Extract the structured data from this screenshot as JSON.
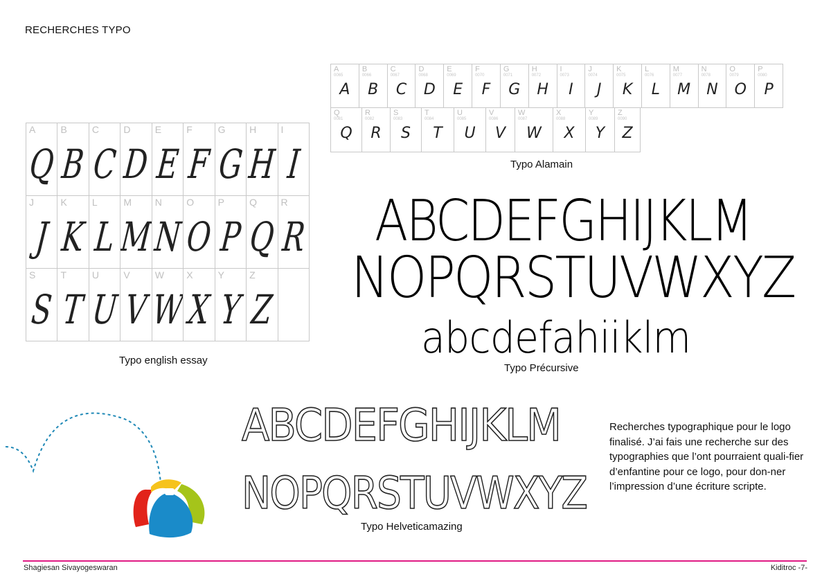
{
  "page_title": "RECHERCHES TYPO",
  "essay": {
    "caption": "Typo english essay",
    "cells": [
      {
        "label": "A",
        "glyph": "Q"
      },
      {
        "label": "B",
        "glyph": "B"
      },
      {
        "label": "C",
        "glyph": "C"
      },
      {
        "label": "D",
        "glyph": "D"
      },
      {
        "label": "E",
        "glyph": "E"
      },
      {
        "label": "F",
        "glyph": "F"
      },
      {
        "label": "G",
        "glyph": "G"
      },
      {
        "label": "H",
        "glyph": "H"
      },
      {
        "label": "I",
        "glyph": "I"
      },
      {
        "label": "J",
        "glyph": "J"
      },
      {
        "label": "K",
        "glyph": "K"
      },
      {
        "label": "L",
        "glyph": "L"
      },
      {
        "label": "M",
        "glyph": "M"
      },
      {
        "label": "N",
        "glyph": "N"
      },
      {
        "label": "O",
        "glyph": "O"
      },
      {
        "label": "P",
        "glyph": "P"
      },
      {
        "label": "Q",
        "glyph": "Q"
      },
      {
        "label": "R",
        "glyph": "R"
      },
      {
        "label": "S",
        "glyph": "S"
      },
      {
        "label": "T",
        "glyph": "T"
      },
      {
        "label": "U",
        "glyph": "U"
      },
      {
        "label": "V",
        "glyph": "V"
      },
      {
        "label": "W",
        "glyph": "W"
      },
      {
        "label": "X",
        "glyph": "X"
      },
      {
        "label": "Y",
        "glyph": "Y"
      },
      {
        "label": "Z",
        "glyph": "Z"
      },
      {
        "label": "",
        "glyph": ""
      }
    ]
  },
  "alamain": {
    "caption": "Typo Alamain",
    "row1": [
      {
        "label": "A",
        "code": "0065",
        "glyph": "A"
      },
      {
        "label": "B",
        "code": "0066",
        "glyph": "B"
      },
      {
        "label": "C",
        "code": "0067",
        "glyph": "C"
      },
      {
        "label": "D",
        "code": "0068",
        "glyph": "D"
      },
      {
        "label": "E",
        "code": "0069",
        "glyph": "E"
      },
      {
        "label": "F",
        "code": "0070",
        "glyph": "F"
      },
      {
        "label": "G",
        "code": "0071",
        "glyph": "G"
      },
      {
        "label": "H",
        "code": "0072",
        "glyph": "H"
      },
      {
        "label": "I",
        "code": "0073",
        "glyph": "I"
      },
      {
        "label": "J",
        "code": "0074",
        "glyph": "J"
      },
      {
        "label": "K",
        "code": "0075",
        "glyph": "K"
      },
      {
        "label": "L",
        "code": "0076",
        "glyph": "L"
      },
      {
        "label": "M",
        "code": "0077",
        "glyph": "M"
      },
      {
        "label": "N",
        "code": "0078",
        "glyph": "N"
      },
      {
        "label": "O",
        "code": "0079",
        "glyph": "O"
      },
      {
        "label": "P",
        "code": "0080",
        "glyph": "P"
      }
    ],
    "row2": [
      {
        "label": "Q",
        "code": "0081",
        "glyph": "Q"
      },
      {
        "label": "R",
        "code": "0082",
        "glyph": "R"
      },
      {
        "label": "S",
        "code": "0083",
        "glyph": "S"
      },
      {
        "label": "T",
        "code": "0084",
        "glyph": "T"
      },
      {
        "label": "U",
        "code": "0085",
        "glyph": "U"
      },
      {
        "label": "V",
        "code": "0086",
        "glyph": "V"
      },
      {
        "label": "W",
        "code": "0087",
        "glyph": "W"
      },
      {
        "label": "X",
        "code": "0088",
        "glyph": "X"
      },
      {
        "label": "Y",
        "code": "0089",
        "glyph": "Y"
      },
      {
        "label": "Z",
        "code": "0090",
        "glyph": "Z"
      }
    ]
  },
  "precursive": {
    "caption": "Typo Précursive",
    "line1": "ABCDEFGHIJKLM",
    "line2": "NOPQRSTUVWXYZ",
    "line3": "abcdefahiiklm"
  },
  "helveticamazing": {
    "caption": "Typo Helveticamazing",
    "line1": "ABCDEFGHIJKLM",
    "line2": "NOPQRSTUVWXYZ"
  },
  "description": "Recherches typographique pour le logo finalisé. J’ai fais une recherche sur des typographies que l’ont pourraient quali-fier d’enfantine pour ce logo, pour don-ner l’impression d’une écriture scripte.",
  "colors": {
    "accent_line": "#e01b84",
    "ball_red": "#e2231a",
    "ball_yellow": "#f6c31c",
    "ball_green": "#a5c41a",
    "ball_blue": "#1a8bc9",
    "dotted_path": "#1e88b6"
  },
  "footer": {
    "author": "Shagiesan Sivayogeswaran",
    "page": "Kiditroc -7-"
  }
}
